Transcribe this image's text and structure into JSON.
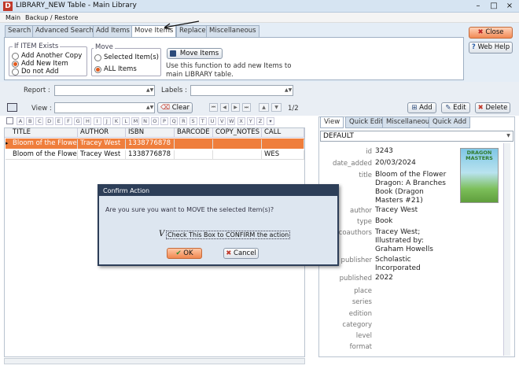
{
  "window": {
    "title": "LIBRARY_NEW Table - Main Library",
    "app_icon": "D",
    "minimize": "–",
    "restore": "□",
    "close": "×"
  },
  "menu": {
    "items": [
      "Main",
      "Backup / Restore"
    ]
  },
  "tabs": [
    "Search",
    "Advanced Search",
    "Add Items",
    "Move Items",
    "Replace",
    "Miscellaneous"
  ],
  "move_panel": {
    "if_exists_legend": "If ITEM Exists",
    "if_exists_options": [
      "Add Another Copy",
      "Add New Item",
      "Do not Add"
    ],
    "if_exists_selected": 1,
    "move_legend": "Move",
    "move_options": [
      "Selected Item(s)",
      "ALL Items"
    ],
    "move_selected": 1,
    "move_button": "Move Items",
    "description": "Use this function to add new Items to main LIBRARY table."
  },
  "side_buttons": {
    "close": "Close",
    "webhelp": "Web Help"
  },
  "filters": {
    "report_label": "Report :",
    "labels_label": "Labels :",
    "view_label": "View :",
    "clear_button": "Clear",
    "page_indicator": "1/2"
  },
  "actions": {
    "add": "Add",
    "edit": "Edit",
    "delete": "Delete"
  },
  "alphabet": [
    "A",
    "B",
    "C",
    "D",
    "E",
    "F",
    "G",
    "H",
    "I",
    "J",
    "K",
    "L",
    "M",
    "N",
    "O",
    "P",
    "Q",
    "R",
    "S",
    "T",
    "U",
    "V",
    "W",
    "X",
    "Y",
    "Z"
  ],
  "table": {
    "columns": [
      "TITLE",
      "AUTHOR",
      "ISBN",
      "BARCODE",
      "COPY_NOTES",
      "CALL"
    ],
    "rows": [
      [
        "Bloom of the Flower I",
        "Tracey West",
        "1338776878",
        "",
        "",
        ""
      ],
      [
        "Bloom of the Flower I",
        "Tracey West",
        "1338776878",
        "",
        "",
        "WES"
      ]
    ]
  },
  "right_panel": {
    "tabs": [
      "View",
      "Quick Edit",
      "Miscellaneous",
      "Quick Add"
    ],
    "view_select": "DEFAULT",
    "fields": [
      {
        "name": "id",
        "value": "3243"
      },
      {
        "name": "date_added",
        "value": "20/03/2024"
      },
      {
        "name": "title",
        "value": "Bloom of the Flower Dragon: A Branches Book (Dragon Masters #21)"
      },
      {
        "name": "author",
        "value": "Tracey West"
      },
      {
        "name": "type",
        "value": "Book"
      },
      {
        "name": "coauthors",
        "value": "Tracey West; Illustrated by: Graham Howells"
      },
      {
        "name": "publisher",
        "value": "Scholastic Incorporated"
      },
      {
        "name": "published",
        "value": "2022"
      },
      {
        "name": "place",
        "value": ""
      },
      {
        "name": "series",
        "value": ""
      },
      {
        "name": "edition",
        "value": ""
      },
      {
        "name": "category",
        "value": ""
      },
      {
        "name": "level",
        "value": ""
      },
      {
        "name": "format",
        "value": ""
      }
    ],
    "cover_text": "DRAGON MASTERS"
  },
  "dialog": {
    "title": "Confirm Action",
    "message": "Are you sure you want to MOVE the selected Item(s)?",
    "checkbox_label": "Check This Box to CONFIRM the action",
    "checkbox_mark": "V",
    "ok": "OK",
    "cancel": "Cancel"
  }
}
